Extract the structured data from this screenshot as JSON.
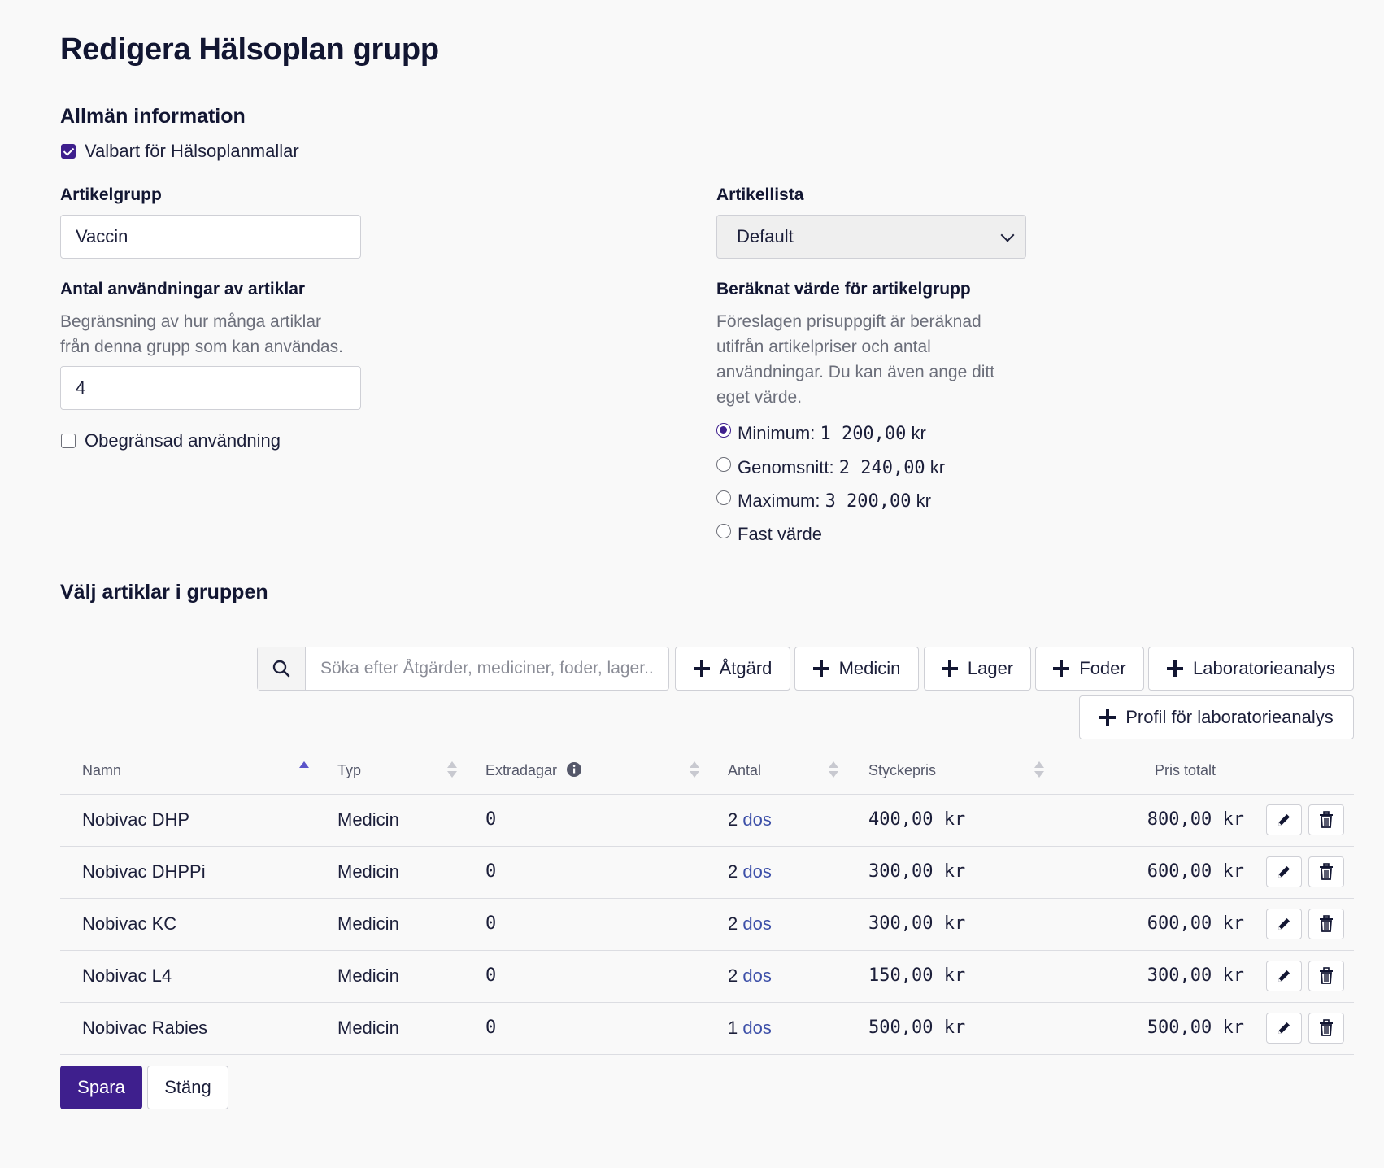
{
  "page": {
    "title": "Redigera Hälsoplan grupp"
  },
  "general": {
    "heading": "Allmän information",
    "selectable_label": "Valbart för Hälsoplanmallar",
    "selectable_checked": true
  },
  "article_group": {
    "label": "Artikelgrupp",
    "value": "Vaccin"
  },
  "article_list": {
    "label": "Artikellista",
    "value": "Default"
  },
  "usage": {
    "label": "Antal användningar av artiklar",
    "help_line1": "Begränsning av hur många artiklar",
    "help_line2": "från denna grupp som kan användas.",
    "value": "4",
    "unlimited_label": "Obegränsad användning",
    "unlimited_checked": false
  },
  "calculated": {
    "label": "Beräknat värde för artikelgrupp",
    "help_line1": "Föreslagen prisuppgift är beräknad",
    "help_line2": "utifrån artikelpriser och antal",
    "help_line3": "användningar. Du kan även ange ditt",
    "help_line4": "eget värde.",
    "options": [
      {
        "prefix": "Minimum: ",
        "amount": "1 200,00",
        "suffix": " kr",
        "checked": true
      },
      {
        "prefix": "Genomsnitt: ",
        "amount": "2 240,00",
        "suffix": " kr",
        "checked": false
      },
      {
        "prefix": "Maximum: ",
        "amount": "3 200,00",
        "suffix": " kr",
        "checked": false
      },
      {
        "prefix": "Fast värde",
        "amount": "",
        "suffix": "",
        "checked": false
      }
    ]
  },
  "articles": {
    "heading": "Välj artiklar i gruppen",
    "search_placeholder": "Söka efter Åtgärder, mediciner, foder, lager...",
    "add_buttons": [
      "Åtgärd",
      "Medicin",
      "Lager",
      "Foder",
      "Laboratorieanalys",
      "Profil för laboratorieanalys"
    ]
  },
  "table": {
    "headers": {
      "name": "Namn",
      "type": "Typ",
      "extra_days": "Extradagar",
      "qty": "Antal",
      "unit_price": "Styckepris",
      "total": "Pris totalt"
    },
    "rows": [
      {
        "name": "Nobivac DHP",
        "type": "Medicin",
        "extra_days": "0",
        "qty": "2",
        "unit": "dos",
        "unit_price": "400,00 kr",
        "total": "800,00 kr"
      },
      {
        "name": "Nobivac DHPPi",
        "type": "Medicin",
        "extra_days": "0",
        "qty": "2",
        "unit": "dos",
        "unit_price": "300,00 kr",
        "total": "600,00 kr"
      },
      {
        "name": "Nobivac KC",
        "type": "Medicin",
        "extra_days": "0",
        "qty": "2",
        "unit": "dos",
        "unit_price": "300,00 kr",
        "total": "600,00 kr"
      },
      {
        "name": "Nobivac L4",
        "type": "Medicin",
        "extra_days": "0",
        "qty": "2",
        "unit": "dos",
        "unit_price": "150,00 kr",
        "total": "300,00 kr"
      },
      {
        "name": "Nobivac Rabies",
        "type": "Medicin",
        "extra_days": "0",
        "qty": "1",
        "unit": "dos",
        "unit_price": "500,00 kr",
        "total": "500,00 kr"
      }
    ]
  },
  "footer": {
    "save_label": "Spara",
    "close_label": "Stäng"
  }
}
